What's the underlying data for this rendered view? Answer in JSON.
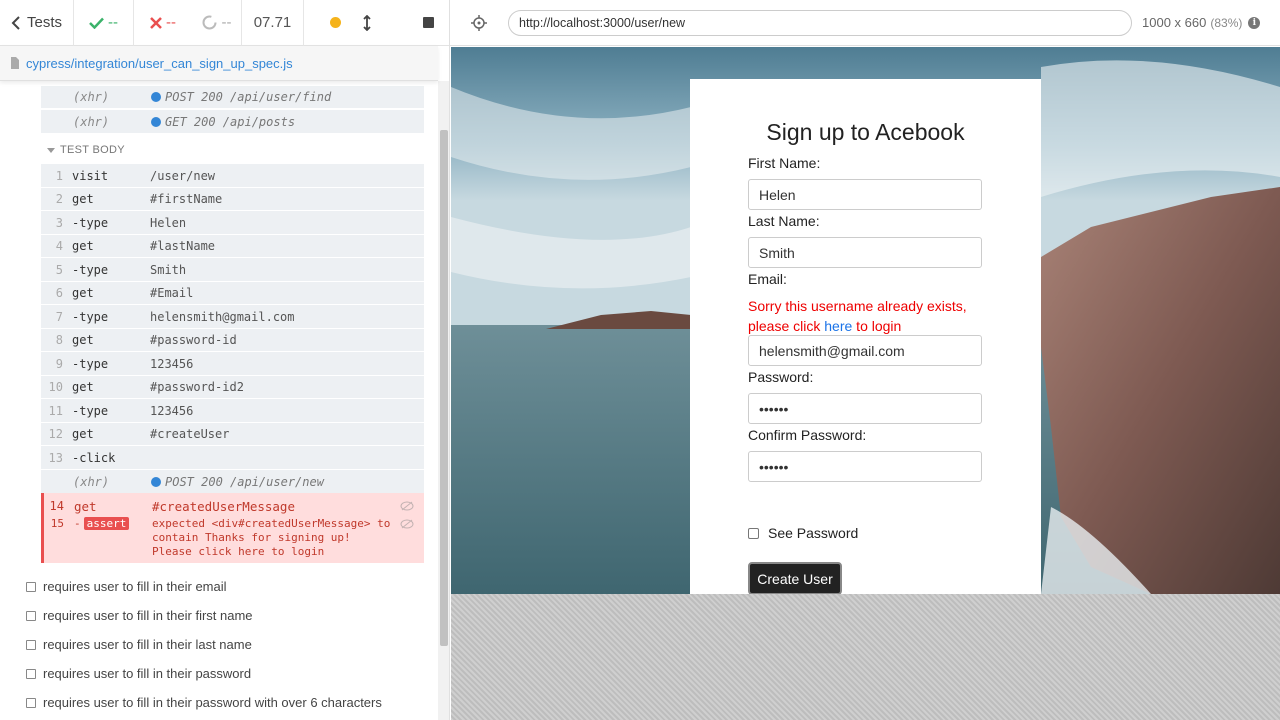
{
  "reporter": {
    "tests_label": "Tests",
    "passed": "--",
    "failed": "--",
    "pending": "--",
    "duration": "07.71",
    "spec_path": "cypress/integration/user_can_sign_up_spec.js",
    "prior_xhr": [
      {
        "type": "(xhr)",
        "msg": "POST 200 /api/user/find"
      },
      {
        "type": "(xhr)",
        "msg": "GET 200 /api/posts"
      }
    ],
    "test_body_label": "TEST BODY",
    "commands": [
      {
        "num": "1",
        "name": "visit",
        "msg": "/user/new"
      },
      {
        "num": "2",
        "name": "get",
        "msg": "#firstName"
      },
      {
        "num": "3",
        "name": "-type",
        "msg": "Helen"
      },
      {
        "num": "4",
        "name": "get",
        "msg": "#lastName"
      },
      {
        "num": "5",
        "name": "-type",
        "msg": "Smith"
      },
      {
        "num": "6",
        "name": "get",
        "msg": "#Email"
      },
      {
        "num": "7",
        "name": "-type",
        "msg": "helensmith@gmail.com"
      },
      {
        "num": "8",
        "name": "get",
        "msg": "#password-id"
      },
      {
        "num": "9",
        "name": "-type",
        "msg": "123456"
      },
      {
        "num": "10",
        "name": "get",
        "msg": "#password-id2"
      },
      {
        "num": "11",
        "name": "-type",
        "msg": "123456"
      },
      {
        "num": "12",
        "name": "get",
        "msg": "#createUser"
      },
      {
        "num": "13",
        "name": "-click",
        "msg": ""
      }
    ],
    "post_xhr": {
      "type": "(xhr)",
      "msg": "POST 200 /api/user/new"
    },
    "failed_cmd": {
      "num": "14",
      "name": "get",
      "msg": "#createdUserMessage"
    },
    "assert_cmd": {
      "num": "15",
      "dash": "-",
      "badge": "assert",
      "msg": "expected <div#createdUserMessage> to contain Thanks for signing up! Please click here to login"
    },
    "tests": [
      "requires user to fill in their email",
      "requires user to fill in their first name",
      "requires user to fill in their last name",
      "requires user to fill in their password",
      "requires user to fill in their password with over 6 characters"
    ]
  },
  "aut": {
    "url": "http://localhost:3000/user/new",
    "viewport": "1000 x 660",
    "scale": "(83%)",
    "info": "i"
  },
  "form": {
    "title": "Sign up to Acebook",
    "first_name_label": "First Name:",
    "first_name_value": "Helen",
    "last_name_label": "Last Name:",
    "last_name_value": "Smith",
    "email_label": "Email:",
    "error_prefix": "Sorry this username already exists, please click ",
    "error_link": "here",
    "error_suffix": " to login",
    "email_value": "helensmith@gmail.com",
    "password_label": "Password:",
    "password_value": "123456",
    "confirm_label": "Confirm Password:",
    "confirm_value": "123456",
    "see_password_label": "See Password",
    "submit_label": "Create User"
  },
  "colors": {
    "pass": "#3bb26a",
    "fail": "#e94f4f",
    "link": "#3386d6",
    "error_text": "#e00000"
  }
}
